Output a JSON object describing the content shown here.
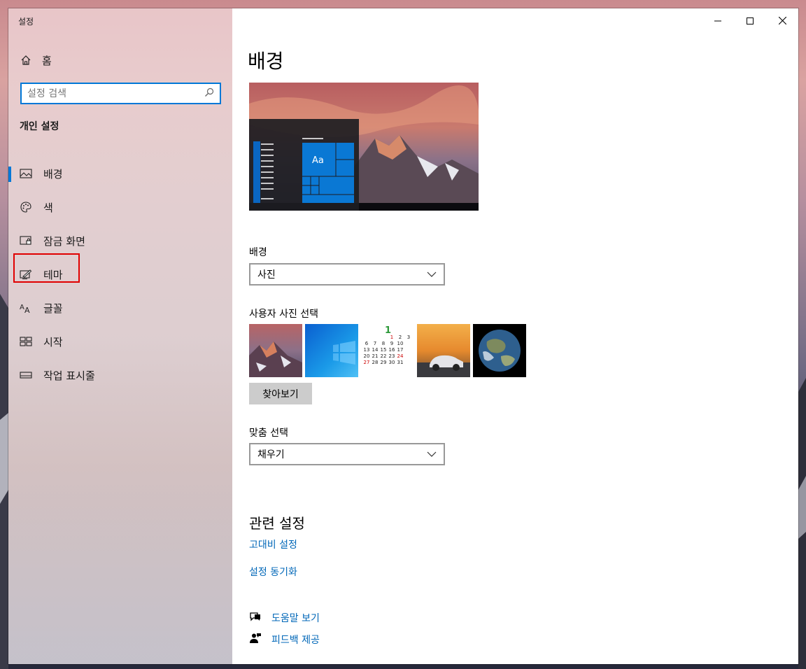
{
  "window": {
    "app_title": "설정"
  },
  "sidebar": {
    "home_label": "홈",
    "search_placeholder": "설정 검색",
    "section_heading": "개인 설정",
    "items": [
      {
        "label": "배경",
        "icon": "picture-icon",
        "active": true
      },
      {
        "label": "색",
        "icon": "palette-icon",
        "active": false
      },
      {
        "label": "잠금 화면",
        "icon": "lock-screen-icon",
        "active": false
      },
      {
        "label": "테마",
        "icon": "theme-icon",
        "active": false
      },
      {
        "label": "글꼴",
        "icon": "font-icon",
        "active": false
      },
      {
        "label": "시작",
        "icon": "start-icon",
        "active": false
      },
      {
        "label": "작업 표시줄",
        "icon": "taskbar-icon",
        "active": false
      }
    ]
  },
  "content": {
    "page_title": "배경",
    "preview_tile_text": "Aa",
    "background_label": "배경",
    "background_value": "사진",
    "choose_photo_label": "사용자 사진 선택",
    "calendar_thumb": {
      "month": "1",
      "days": [
        "1",
        "2",
        "3",
        "6",
        "7",
        "8",
        "9",
        "10",
        "13",
        "14",
        "15",
        "16",
        "17",
        "20",
        "21",
        "22",
        "23",
        "24",
        "27",
        "28",
        "29",
        "30",
        "31"
      ]
    },
    "browse_label": "찾아보기",
    "fit_label": "맞춤 선택",
    "fit_value": "채우기",
    "related_heading": "관련 설정",
    "related_links": [
      "고대비 설정",
      "설정 동기화"
    ],
    "help_label": "도움말 보기",
    "feedback_label": "피드백 제공"
  },
  "colors": {
    "accent": "#0078d7",
    "link": "#0067b8",
    "highlight": "#e00000"
  }
}
